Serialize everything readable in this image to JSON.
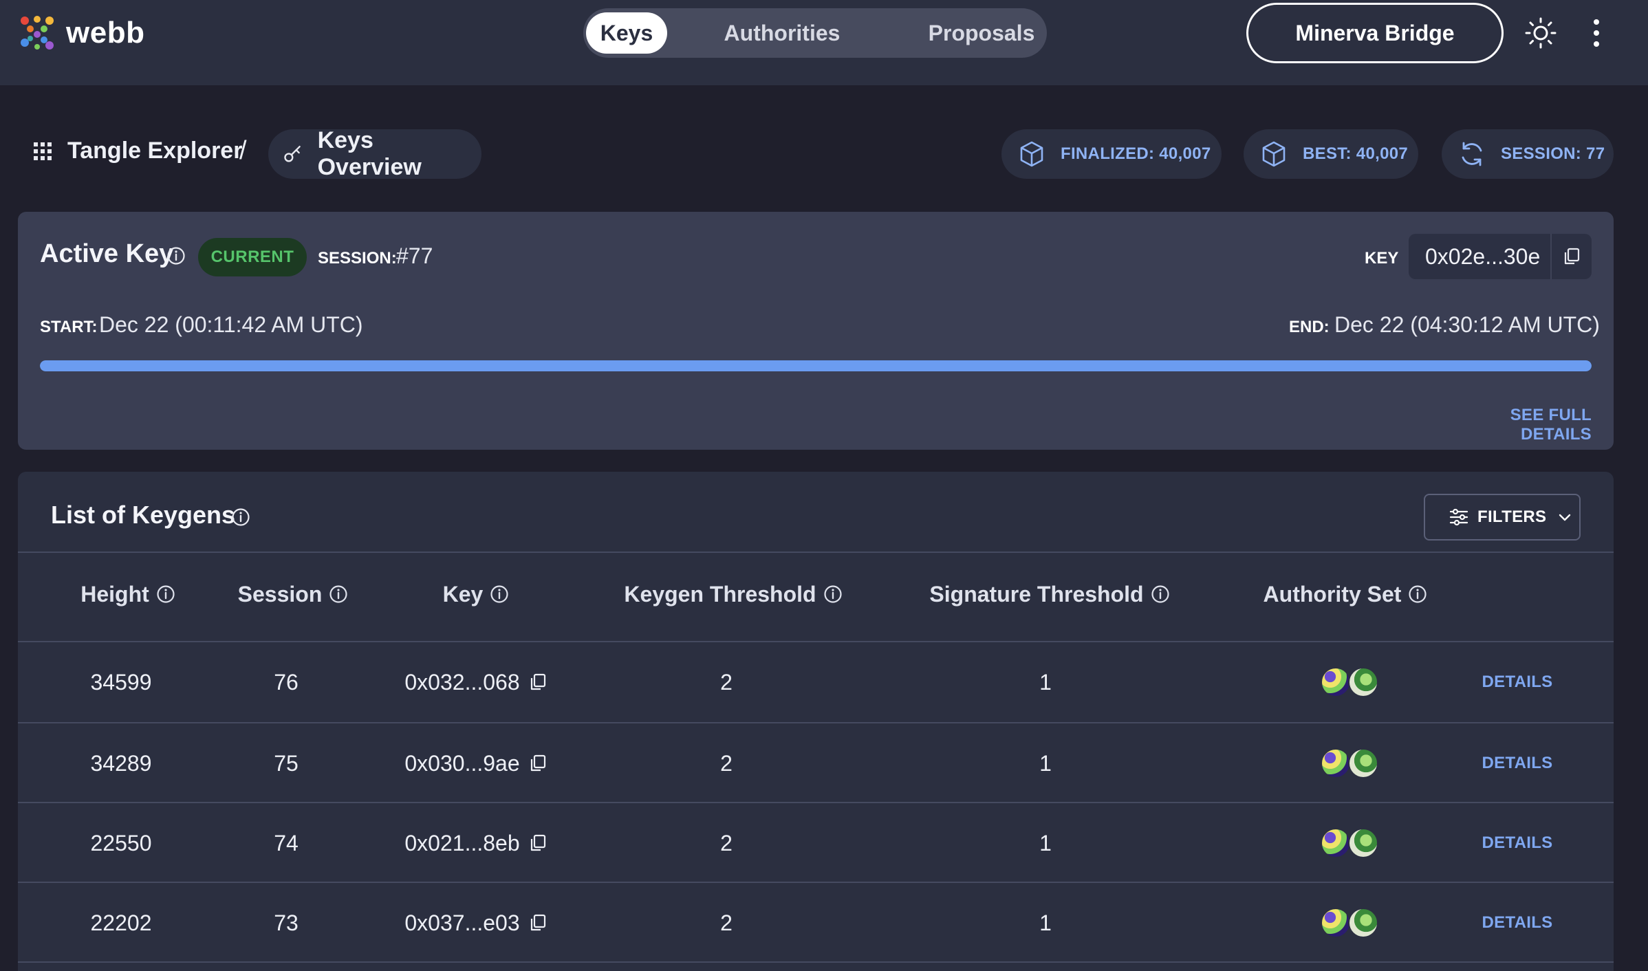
{
  "header": {
    "logo_text": "webb",
    "tabs": [
      {
        "label": "Keys",
        "active": true
      },
      {
        "label": "Authorities",
        "active": false
      },
      {
        "label": "Proposals",
        "active": false
      }
    ],
    "network_button": "Minerva Bridge",
    "icons": {
      "theme": "sun-icon",
      "more": "more-vertical-icon"
    }
  },
  "breadcrumb": {
    "root": "Tangle Explorer",
    "separator": "/",
    "current": "Keys Overview"
  },
  "stats": [
    {
      "label": "FINALIZED: 40,007",
      "icon": "cube-icon"
    },
    {
      "label": "BEST: 40,007",
      "icon": "cube-icon"
    },
    {
      "label": "SESSION: 77",
      "icon": "refresh-icon"
    }
  ],
  "active_key": {
    "title": "Active Key",
    "badge": "CURRENT",
    "session_label": "SESSION:",
    "session_value": "#77",
    "key_label": "KEY",
    "key_value": "0x02e...30e",
    "start_label": "START:",
    "start_value": "Dec 22 (00:11:42 AM UTC)",
    "end_label": "END:",
    "end_value": "Dec 22 (04:30:12 AM UTC)",
    "progress": 1.0,
    "see_details": "SEE FULL DETAILS"
  },
  "keygens": {
    "title": "List of Keygens",
    "filters_label": "FILTERS",
    "columns": [
      "Height",
      "Session",
      "Key",
      "Keygen Threshold",
      "Signature Threshold",
      "Authority Set"
    ],
    "rows": [
      {
        "height": "34599",
        "session": "76",
        "key": "0x032...068",
        "keygen_threshold": "2",
        "signature_threshold": "1",
        "action": "DETAILS"
      },
      {
        "height": "34289",
        "session": "75",
        "key": "0x030...9ae",
        "keygen_threshold": "2",
        "signature_threshold": "1",
        "action": "DETAILS"
      },
      {
        "height": "22550",
        "session": "74",
        "key": "0x021...8eb",
        "keygen_threshold": "2",
        "signature_threshold": "1",
        "action": "DETAILS"
      },
      {
        "height": "22202",
        "session": "73",
        "key": "0x037...e03",
        "keygen_threshold": "2",
        "signature_threshold": "1",
        "action": "DETAILS"
      }
    ]
  },
  "colors": {
    "background": "#1f1f2c",
    "panel": "#2b2f40",
    "card": "#3a3e53",
    "accent": "#6b9cf0",
    "link": "#7fa7f0",
    "badge_bg": "#1c3a22",
    "badge_text": "#56c46b"
  }
}
